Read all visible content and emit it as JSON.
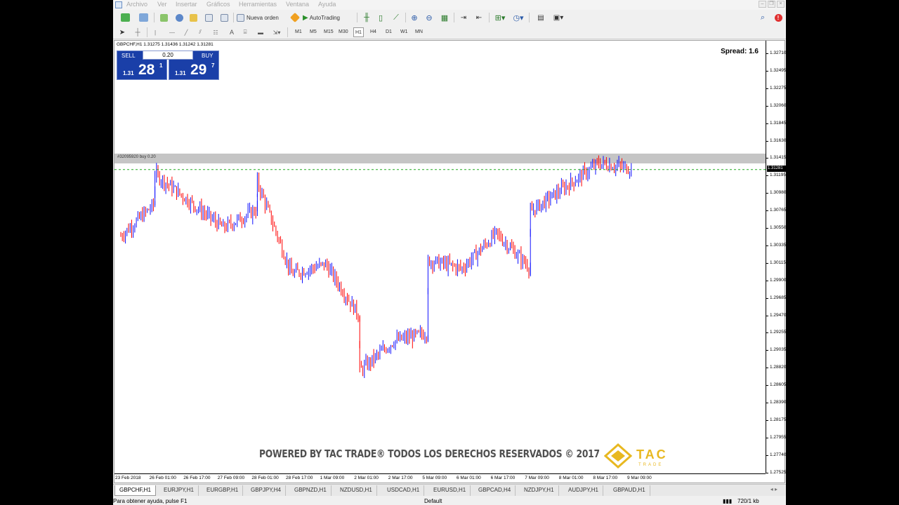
{
  "menu": [
    "Archivo",
    "Ver",
    "Insertar",
    "Gráficos",
    "Herramientas",
    "Ventana",
    "Ayuda"
  ],
  "toolbar": {
    "new_order_label": "Nueva orden",
    "autotrading_label": "AutoTrading",
    "timeframes": [
      "M1",
      "M5",
      "M15",
      "M30",
      "H1",
      "H4",
      "D1",
      "W1",
      "MN"
    ],
    "active_timeframe": "H1"
  },
  "chart": {
    "symbol_line": "GBPCHF,H1  1.31275 1.31436 1.31242 1.31281",
    "spread_text": "Spread: 1.6",
    "trade_label": "#32095920 buy 0.20",
    "bid_tag": "1.31281",
    "price_labels": [
      "1.32710",
      "1.32495",
      "1.32275",
      "1.32060",
      "1.31845",
      "1.31630",
      "1.31415",
      "1.31195",
      "1.30980",
      "1.30765",
      "1.30550",
      "1.30335",
      "1.30115",
      "1.29900",
      "1.29685",
      "1.29470",
      "1.29255",
      "1.29035",
      "1.28820",
      "1.28605",
      "1.28390",
      "1.28175",
      "1.27955",
      "1.27740",
      "1.27525"
    ],
    "time_labels": [
      "23 Feb 2018",
      "26 Feb 01:00",
      "26 Feb 17:00",
      "27 Feb 09:00",
      "28 Feb 01:00",
      "28 Feb 17:00",
      "1 Mar 09:00",
      "2 Mar 01:00",
      "2 Mar 17:00",
      "5 Mar 09:00",
      "6 Mar 01:00",
      "6 Mar 17:00",
      "7 Mar 09:00",
      "8 Mar 01:00",
      "8 Mar 17:00",
      "9 Mar 09:00"
    ],
    "colors": {
      "bull": "#1010ff",
      "bear": "#ff0000",
      "background": "#ffffff"
    }
  },
  "one_click": {
    "sell_label": "SELL",
    "buy_label": "BUY",
    "lot": "0.20",
    "sell_prefix": "1.31",
    "sell_big": "28",
    "sell_sup": "1",
    "buy_prefix": "1.31",
    "buy_big": "29",
    "buy_sup": "7"
  },
  "watermark": {
    "text": "POWERED BY TAC TRADE® TODOS LOS DERECHOS RESERVADOS © 2017",
    "logo_text": "TAC",
    "logo_sub": "TRADE"
  },
  "tabs": [
    "GBPCHF,H1",
    "EURJPY,H1",
    "EURGBP,H1",
    "GBPJPY,H4",
    "GBPNZD,H1",
    "NZDUSD,H1",
    "USDCAD,H1",
    "EURUSD,H1",
    "GBPCAD,H4",
    "NZDJPY,H1",
    "AUDJPY,H1",
    "GBPAUD,H1"
  ],
  "status": {
    "help": "Para obtener ayuda, pulse F1",
    "profile": "Default",
    "traffic": "720/1 kb"
  },
  "chart_data": {
    "type": "candlestick",
    "symbol": "GBPCHF",
    "timeframe": "H1",
    "ylim": [
      1.2752,
      1.3282
    ],
    "last": {
      "open": 1.31275,
      "high": 1.31436,
      "low": 1.31242,
      "close": 1.31281
    },
    "trend_keypoints": [
      {
        "x": "23 Feb 2018",
        "y": 1.3045
      },
      {
        "x": "26 Feb 01:00",
        "y": 1.3085
      },
      {
        "x": "26 Feb 01:00",
        "y": 1.3122
      },
      {
        "x": "26 Feb 17:00",
        "y": 1.3088
      },
      {
        "x": "27 Feb 09:00",
        "y": 1.3055
      },
      {
        "x": "28 Feb 01:00",
        "y": 1.3078
      },
      {
        "x": "28 Feb 01:00",
        "y": 1.3112
      },
      {
        "x": "28 Feb 17:00",
        "y": 1.2998
      },
      {
        "x": "1 Mar 09:00",
        "y": 1.301
      },
      {
        "x": "2 Mar 01:00",
        "y": 1.2945
      },
      {
        "x": "2 Mar 01:00",
        "y": 1.2878
      },
      {
        "x": "2 Mar 17:00",
        "y": 1.2915
      },
      {
        "x": "5 Mar 09:00",
        "y": 1.2925
      },
      {
        "x": "5 Mar 09:00",
        "y": 1.3015
      },
      {
        "x": "6 Mar 01:00",
        "y": 1.3005
      },
      {
        "x": "6 Mar 17:00",
        "y": 1.3048
      },
      {
        "x": "7 Mar 09:00",
        "y": 1.3005
      },
      {
        "x": "7 Mar 09:00",
        "y": 1.3075
      },
      {
        "x": "8 Mar 01:00",
        "y": 1.3105
      },
      {
        "x": "8 Mar 17:00",
        "y": 1.3135
      },
      {
        "x": "9 Mar 09:00",
        "y": 1.3128
      }
    ]
  }
}
